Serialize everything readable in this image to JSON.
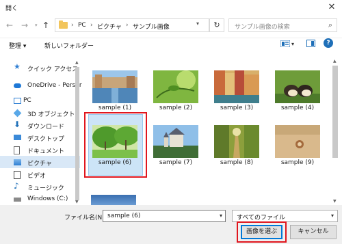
{
  "window": {
    "title": "開く",
    "close_glyph": "✕"
  },
  "nav": {
    "back": "←",
    "forward": "→",
    "up": "↑",
    "refresh": "↻"
  },
  "breadcrumb": [
    "PC",
    "ピクチャ",
    "サンプル画像"
  ],
  "breadcrumb_sep": "›",
  "search": {
    "placeholder": "サンプル画像の検索"
  },
  "toolbar": {
    "organize": "整理 ▾",
    "new_folder": "新しいフォルダー"
  },
  "sidebar": {
    "items": [
      {
        "label": "クイック アクセス",
        "icon": "star-icon"
      },
      {
        "label": "OneDrive - Persor",
        "icon": "cloud-icon"
      },
      {
        "label": "PC",
        "icon": "pc-icon"
      },
      {
        "label": "3D オブジェクト",
        "icon": "cube-icon"
      },
      {
        "label": "ダウンロード",
        "icon": "download-icon"
      },
      {
        "label": "デスクトップ",
        "icon": "desktop-icon"
      },
      {
        "label": "ドキュメント",
        "icon": "document-icon"
      },
      {
        "label": "ピクチャ",
        "icon": "pictures-icon",
        "selected": true
      },
      {
        "label": "ビデオ",
        "icon": "video-icon"
      },
      {
        "label": "ミュージック",
        "icon": "music-icon"
      },
      {
        "label": "Windows (C:)",
        "icon": "drive-icon"
      }
    ]
  },
  "files": [
    {
      "label": "sample (1)",
      "scene": "canal-city"
    },
    {
      "label": "sample (2)",
      "scene": "green-plant"
    },
    {
      "label": "sample (3)",
      "scene": "colorful-buildings"
    },
    {
      "label": "sample (4)",
      "scene": "ducklings"
    },
    {
      "label": "sample (6)",
      "scene": "green-park",
      "selected": true
    },
    {
      "label": "sample (7)",
      "scene": "castle"
    },
    {
      "label": "sample (8)",
      "scene": "forest-path"
    },
    {
      "label": "sample (9)",
      "scene": "sand-shell"
    }
  ],
  "bottom": {
    "filename_label": "ファイル名(N):",
    "filename_value": "sample (6)",
    "filter_value": "すべてのファイル",
    "open_button": "画像を選ぶ",
    "cancel_button": "キャンセル"
  },
  "colors": {
    "accent": "#0078d7",
    "highlight": "#e0161e",
    "selection": "#cce4f7"
  }
}
